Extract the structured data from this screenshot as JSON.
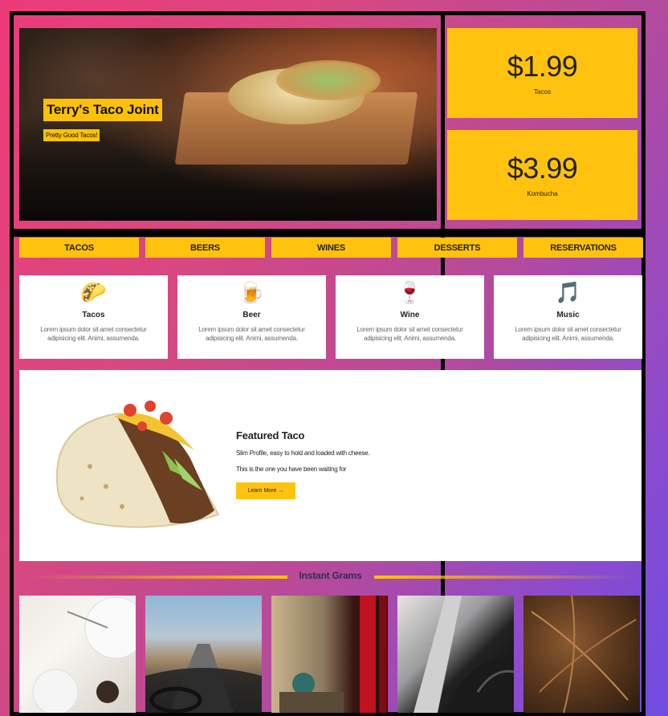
{
  "hero": {
    "title": "Terry's Taco Joint",
    "subtitle": "Pretty Good Tacos!"
  },
  "prices": [
    {
      "amount": "$1.99",
      "label": "Tacos"
    },
    {
      "amount": "$3.99",
      "label": "Kombucha"
    }
  ],
  "nav": [
    "TACOS",
    "BEERS",
    "WINES",
    "DESSERTS",
    "RESERVATIONS"
  ],
  "features": [
    {
      "icon": "🌮",
      "icon_name": "taco-icon",
      "title": "Tacos",
      "text": "Lorem ipsum dolor sit amet consectetur adipisicing elit. Animi, assumenda."
    },
    {
      "icon": "🍺",
      "icon_name": "beer-icon",
      "title": "Beer",
      "text": "Lorem ipsum dolor sit amet consectetur adipisicing elit. Animi, assumenda."
    },
    {
      "icon": "🍷",
      "icon_name": "wine-icon",
      "title": "Wine",
      "text": "Lorem ipsum dolor sit amet consectetur adipisicing elit. Animi, assumenda."
    },
    {
      "icon": "🎵",
      "icon_name": "music-icon",
      "title": "Music",
      "text": "Lorem ipsum dolor sit amet consectetur adipisicing elit. Animi, assumenda."
    }
  ],
  "featured": {
    "title": "Featured Taco",
    "line1": "Slim Profile, easy to hold and loaded with cheese.",
    "line2": "This is the one you have been waiting for",
    "button": "Learn More →"
  },
  "grams": {
    "title": "Instant Grams",
    "photos": [
      "baking-photo",
      "road-trip-photo",
      "exchange-sign-photo",
      "architecture-photo",
      "fern-leaves-photo"
    ]
  },
  "colors": {
    "accent": "#ffc20e",
    "gradient_start": "#ee3a7a",
    "gradient_end": "#6f4ce0"
  }
}
